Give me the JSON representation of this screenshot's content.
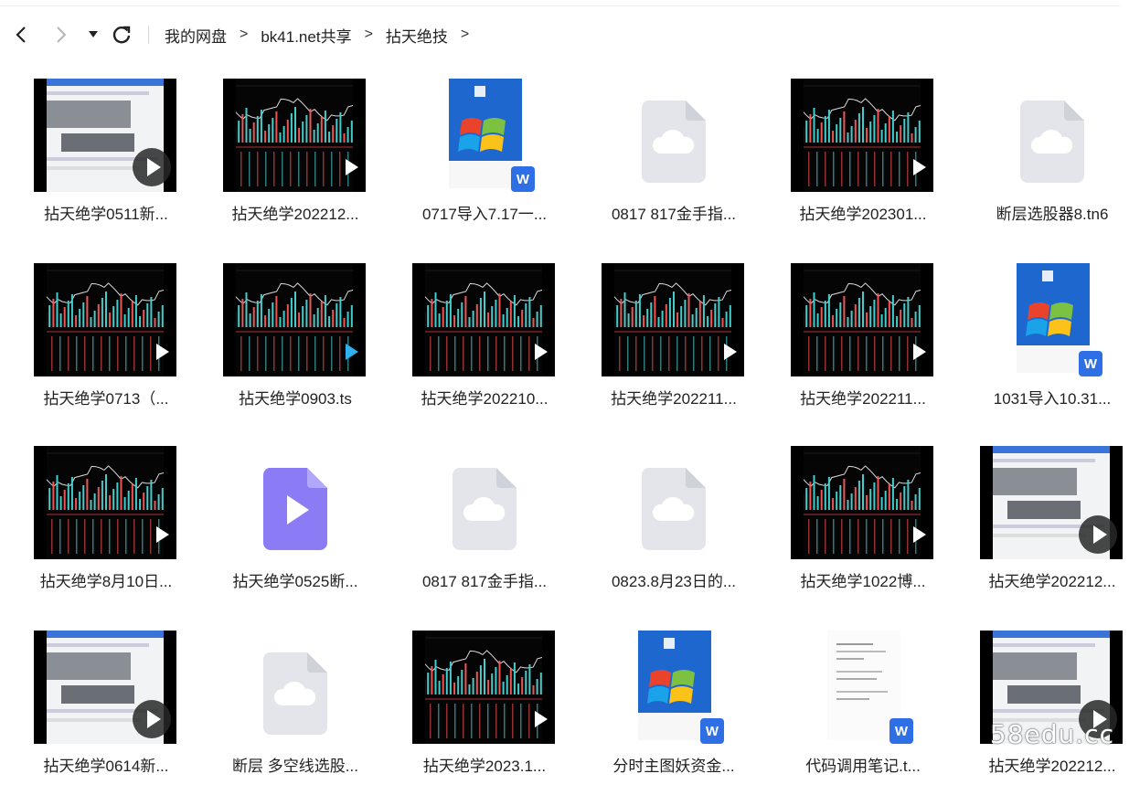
{
  "toolbar": {
    "back_icon": "chevron-left-icon",
    "forward_icon": "chevron-right-icon",
    "dropdown_icon": "caret-down-icon",
    "refresh_icon": "refresh-icon"
  },
  "breadcrumb": {
    "items": [
      "我的网盘",
      "bk41.net共享",
      "拈天绝技"
    ],
    "separator": ">"
  },
  "files": [
    {
      "name": "拈天绝学0511新...",
      "kind": "video-light"
    },
    {
      "name": "拈天绝学202212...",
      "kind": "video-dark"
    },
    {
      "name": "0717导入7.17一...",
      "kind": "doc-win"
    },
    {
      "name": "0817 817金手指...",
      "kind": "cloud"
    },
    {
      "name": "拈天绝学202301...",
      "kind": "video-dark"
    },
    {
      "name": "断层选股器8.tn6",
      "kind": "cloud"
    },
    {
      "name": "拈天绝学0713（...",
      "kind": "video-dark"
    },
    {
      "name": "拈天绝学0903.ts",
      "kind": "video-dark-selected"
    },
    {
      "name": "拈天绝学202210...",
      "kind": "video-dark"
    },
    {
      "name": "拈天绝学202211...",
      "kind": "video-dark"
    },
    {
      "name": "拈天绝学202211...",
      "kind": "video-dark"
    },
    {
      "name": "1031导入10.31...",
      "kind": "doc-win"
    },
    {
      "name": "拈天绝学8月10日...",
      "kind": "video-dark"
    },
    {
      "name": "拈天绝学0525断...",
      "kind": "video-file"
    },
    {
      "name": "0817 817金手指...",
      "kind": "cloud"
    },
    {
      "name": "0823.8月23日的...",
      "kind": "cloud"
    },
    {
      "name": "拈天绝学1022博...",
      "kind": "video-dark"
    },
    {
      "name": "拈天绝学202212...",
      "kind": "video-light"
    },
    {
      "name": "拈天绝学0614新...",
      "kind": "video-light"
    },
    {
      "name": "断层 多空线选股...",
      "kind": "cloud"
    },
    {
      "name": "拈天绝学2023.1...",
      "kind": "video-dark"
    },
    {
      "name": "分时主图妖资金...",
      "kind": "doc-win"
    },
    {
      "name": "代码调用笔记.t...",
      "kind": "doc-white"
    },
    {
      "name": "拈天绝学202212...",
      "kind": "video-light"
    }
  ],
  "watermark": "58edu.cc",
  "colors": {
    "accent": "#2f6fe6",
    "video_icon": "#8b7cf6",
    "cloud_file": "#e3e5ea"
  }
}
